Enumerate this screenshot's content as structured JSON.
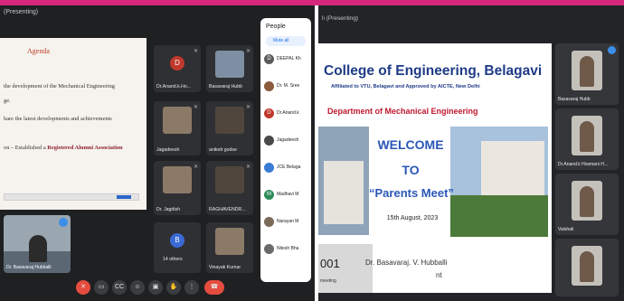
{
  "left_panel": {
    "meeting_title": "(Presenting)",
    "slide": {
      "heading": "Agenda",
      "lines": [
        "the development of the Mechanical Engineering",
        "ge.",
        "hare the latest developments and achievements",
        "on – Established a ",
        "Registered Alumni Association"
      ]
    },
    "self_view_name": "Dr. Basavaraj Hubballi",
    "tiles": [
      {
        "name": "Dr.Anand.k.Ho...",
        "avatar": "D",
        "avatar_color": "#c0392b"
      },
      {
        "name": "Basavaraj Hubb",
        "avatar": "",
        "avatar_color": ""
      },
      {
        "name": "Jagadeesh",
        "avatar": "",
        "avatar_color": ""
      },
      {
        "name": "anikett godse",
        "avatar": "",
        "avatar_color": ""
      },
      {
        "name": "Dr. Jagdish",
        "avatar": "",
        "avatar_color": ""
      },
      {
        "name": "RAGHAVENDR...",
        "avatar": "",
        "avatar_color": ""
      },
      {
        "name": "14 others",
        "avatar": "B",
        "avatar_color": "#3b6ad6"
      },
      {
        "name": "Vinayak Kumar",
        "avatar": "",
        "avatar_color": ""
      }
    ],
    "people_panel": {
      "title": "People",
      "mute_all": "Mute all",
      "participants": [
        {
          "name": "DEEPAL Kh",
          "initial": "D",
          "color": "#5a5a5a"
        },
        {
          "name": "Dr. M. Sree",
          "initial": "",
          "color": "#8b5a3c"
        },
        {
          "name": "Dr.Anand.k",
          "initial": "D",
          "color": "#c0392b"
        },
        {
          "name": "Jagadeesh",
          "initial": "",
          "color": "#4a4a4a"
        },
        {
          "name": "JCE Belaga",
          "initial": "",
          "color": "#3a7bd5"
        },
        {
          "name": "Madhavi M",
          "initial": "M",
          "color": "#2e8b57"
        },
        {
          "name": "Narayan M",
          "initial": "",
          "color": "#7a6a5a"
        },
        {
          "name": "Nitesh Bha",
          "initial": "",
          "color": "#6a6a6a"
        }
      ]
    },
    "controls": [
      "mic-off",
      "camera",
      "captions",
      "emoji",
      "present",
      "raise-hand",
      "more",
      "end-call"
    ]
  },
  "right_panel": {
    "meeting_title": "li (Presenting)",
    "slide": {
      "college": "College of Engineering, Belagavi",
      "affiliation": "Affiliated to VTU, Belagavi and Approved by AICTE, New Delhi",
      "department": "Department of Mechanical Engineering",
      "welcome": "WELCOME",
      "to": "TO",
      "event": "“Parents Meet”",
      "date": "15th August, 2023",
      "speaker": "Dr. Basavaraj. V. Hubballi",
      "footer_number": "001",
      "footer_label": "meeting",
      "tail": "nt"
    },
    "tiles": [
      {
        "name": "Basavaraj Hubb"
      },
      {
        "name": "Dr.Anand.k Hosmani H..."
      },
      {
        "name": "Vaishali"
      },
      {
        "name": ""
      }
    ]
  }
}
